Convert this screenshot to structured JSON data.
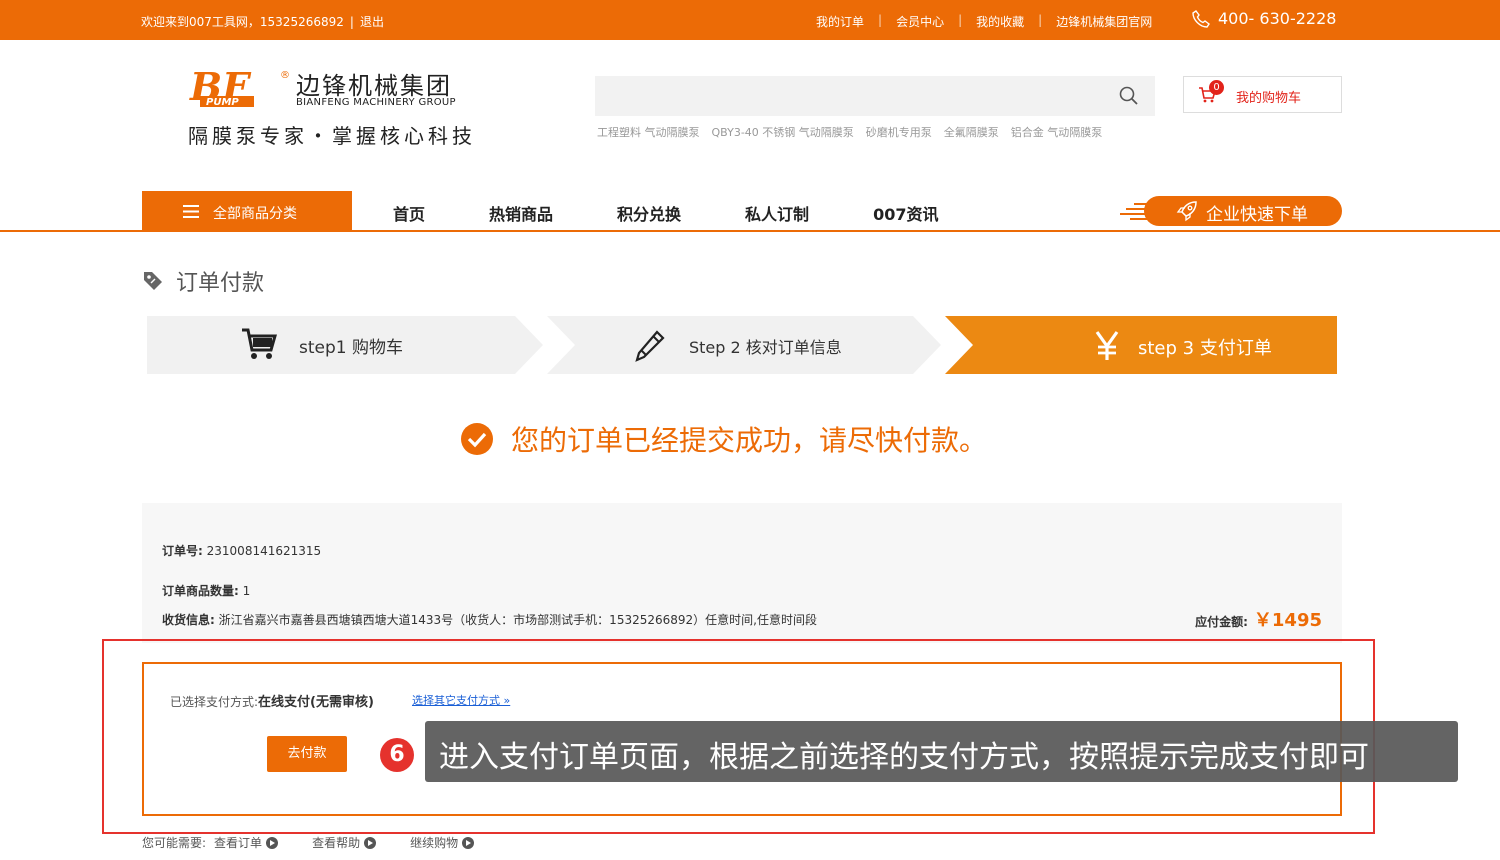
{
  "topbar": {
    "welcome": "欢迎来到007工具网，15325266892",
    "logout": "退出",
    "links": [
      "我的订单",
      "会员中心",
      "我的收藏",
      "边锋机械集团官网"
    ],
    "phone": "400- 630-2228"
  },
  "logo": {
    "cn_name": "边锋机械集团",
    "en_name": "BIANFENG MACHINERY GROUP",
    "slogan": "隔膜泵专家・掌握核心科技",
    "mark_text": "BF",
    "mark_sub": "PUMP"
  },
  "search": {
    "placeholder": "",
    "hotwords": [
      "工程塑料 气动隔膜泵",
      "QBY3-40 不锈钢 气动隔膜泵",
      "砂磨机专用泵",
      "全氟隔膜泵",
      "铝合金 气动隔膜泵"
    ]
  },
  "cart": {
    "count": "0",
    "label": "我的购物车"
  },
  "nav": {
    "category_label": "全部商品分类",
    "items": [
      "首页",
      "热销商品",
      "积分兑换",
      "私人订制",
      "007资讯"
    ],
    "quick_order": "企业快速下单"
  },
  "page_title": "订单付款",
  "steps": [
    {
      "label": "step1  购物车",
      "icon": "cart-icon",
      "active": false
    },
    {
      "label": "Step 2 核对订单信息",
      "icon": "pencil-icon",
      "active": true
    },
    {
      "label": "step 3 支付订单",
      "icon": "yen-icon",
      "active": true
    }
  ],
  "success_message": "您的订单已经提交成功，请尽快付款。",
  "order": {
    "number_label": "订单号:",
    "number": "231008141621315",
    "qty_label": "订单商品数量:",
    "qty": "1",
    "address_label": "收货信息:",
    "address": "浙江省嘉兴市嘉善县西塘镇西塘大道1433号（收货人：市场部测试手机：15325266892）任意时间,任意时间段",
    "amount_label": "应付金额:",
    "amount": "￥1495"
  },
  "payment": {
    "method_label": "已选择支付方式:",
    "method": "在线支付(无需审核)",
    "other_link": "选择其它支付方式 »",
    "pay_button": "去付款"
  },
  "annotation": {
    "number": "6",
    "text": "进入支付订单页面，根据之前选择的支付方式，按照提示完成支付即可"
  },
  "footer_links": {
    "prefix": "您可能需要:",
    "items": [
      "查看订单",
      "查看帮助",
      "继续购物"
    ]
  },
  "colors": {
    "brand": "#ec6b06",
    "alert_red": "#e5322d",
    "link_blue": "#1a5fd6"
  }
}
